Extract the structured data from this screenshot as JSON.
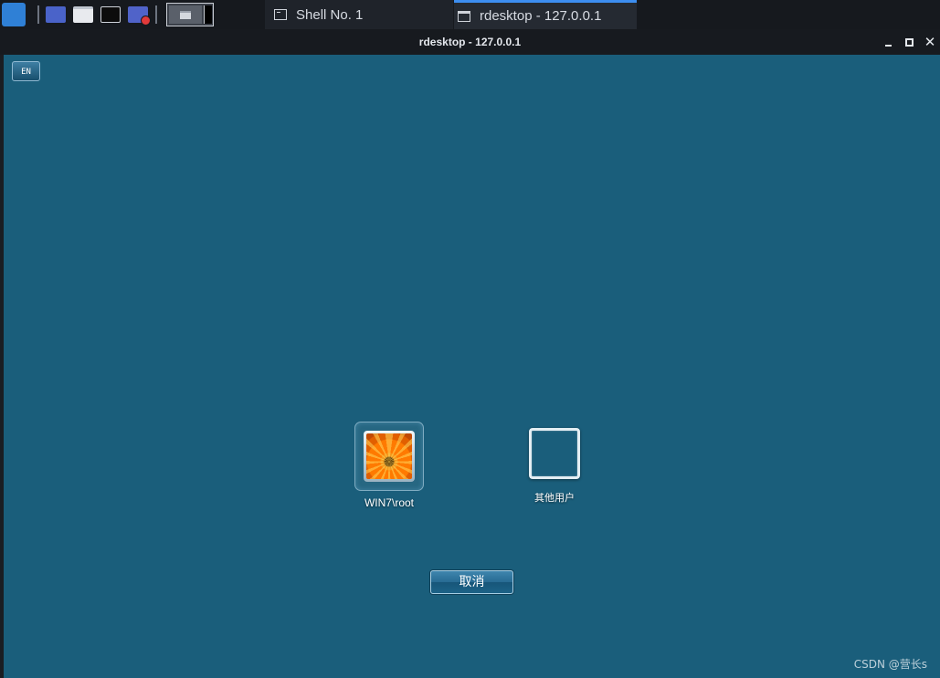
{
  "taskbar": {
    "tasks": [
      {
        "label": "Shell No. 1",
        "icon": "terminal-icon",
        "active": false
      },
      {
        "label": "rdesktop - 127.0.0.1",
        "icon": "window-icon",
        "active": true
      }
    ]
  },
  "window": {
    "title": "rdesktop - 127.0.0.1",
    "buttons": [
      "minimize-icon",
      "maximize-icon",
      "close-icon"
    ],
    "close_glyph": "✕"
  },
  "desktop": {
    "language_indicator": "EN",
    "users": [
      {
        "label": "WIN7\\root"
      },
      {
        "label": "其他用户"
      }
    ],
    "cancel_label": "取消",
    "background_color": "#1a5e7b"
  },
  "watermark": "CSDN @营长s"
}
